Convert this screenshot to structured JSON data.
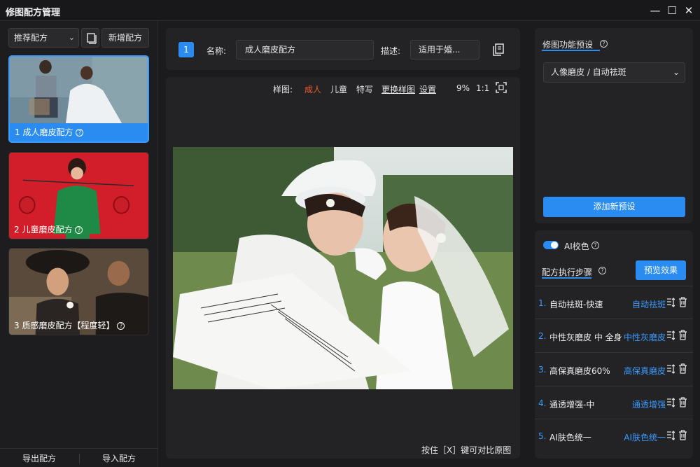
{
  "window": {
    "title": "修图配方管理",
    "minimize": "—",
    "maximize": "☐",
    "close": "✕"
  },
  "sidebar": {
    "dropdown_value": "推荐配方",
    "new_label": "新增配方",
    "presets": [
      {
        "label": "1 成人磨皮配方",
        "active": true
      },
      {
        "label": "2 儿童磨皮配方",
        "active": false
      },
      {
        "label": "3 质感磨皮配方【程度轻】",
        "active": false
      }
    ],
    "export_label": "导出配方",
    "import_label": "导入配方"
  },
  "editor": {
    "index": "1",
    "name_label": "名称:",
    "name_value": "成人磨皮配方",
    "desc_label": "描述:",
    "desc_value": "适用于婚..."
  },
  "preview": {
    "sample_label": "样图:",
    "options": {
      "adult": "成人",
      "child": "儿童",
      "closeup": "特写",
      "change": "更换样图",
      "settings": "设置"
    },
    "zoom": "9%",
    "ratio": "1:1",
    "hint": "按住［X］键可对比原图"
  },
  "function_preset": {
    "title": "修图功能预设",
    "selected": "人像磨皮 / 自动祛斑",
    "add_label": "添加新预设"
  },
  "steps": {
    "ai_label": "AI校色",
    "ai_enabled": true,
    "title": "配方执行步骤",
    "preview_label": "预览效果",
    "items": [
      {
        "num": "1.",
        "name": "自动祛斑-快速",
        "link": "自动祛斑"
      },
      {
        "num": "2.",
        "name": "中性灰磨皮 中 全身",
        "link": "中性灰磨皮"
      },
      {
        "num": "3.",
        "name": "高保真磨皮60%",
        "link": "高保真磨皮"
      },
      {
        "num": "4.",
        "name": "通透增强-中",
        "link": "通透增强"
      },
      {
        "num": "5.",
        "name": "AI肤色统一",
        "link": "AI肤色统一"
      }
    ]
  },
  "colors": {
    "accent": "#2a8cf0",
    "highlight": "#f05a2a",
    "background": "#1b1b1d",
    "panel": "#232326"
  }
}
